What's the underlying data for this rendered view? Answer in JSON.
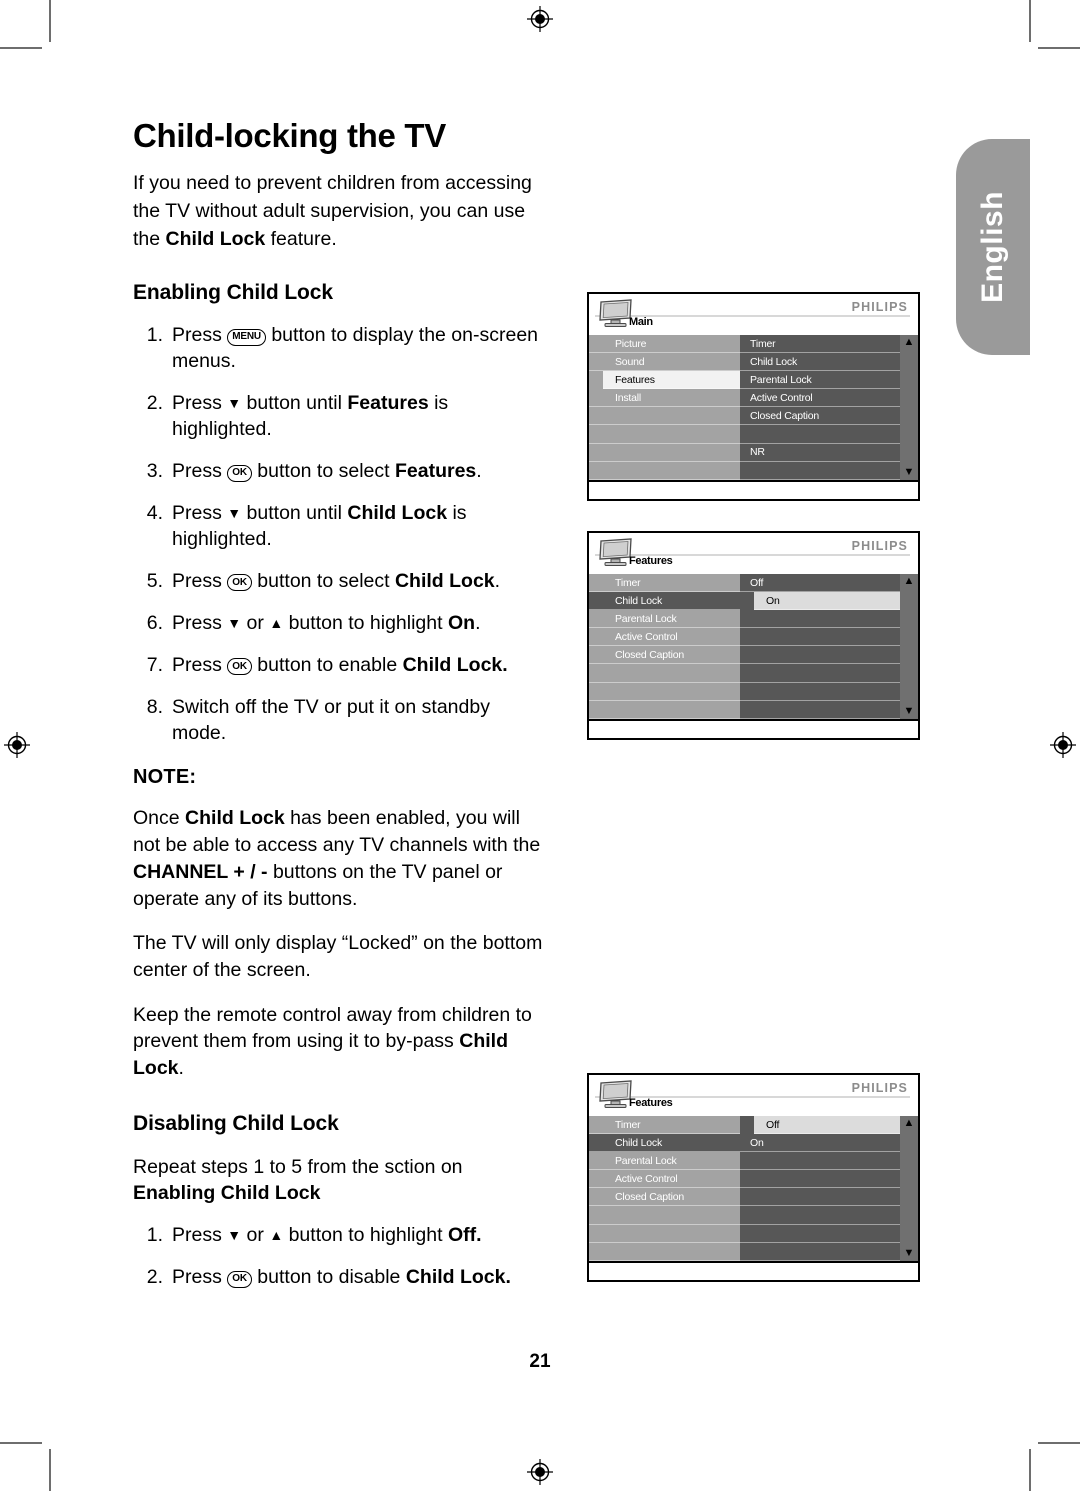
{
  "page": {
    "number": "21",
    "language_tab": "English"
  },
  "article": {
    "title": "Child-locking the TV",
    "intro_plain": "If you need to prevent children from accessing the TV without adult supervision, you can use the Child Lock feature.",
    "intro_pre": "If you need to prevent children from accessing the TV without adult supervision, you can use the ",
    "intro_bold": "Child Lock",
    "intro_post": " feature."
  },
  "enabling": {
    "heading": "Enabling Child Lock",
    "steps": [
      {
        "num": "1.",
        "pre": "Press ",
        "glyph": "MENU",
        "post": " button to display the on-screen menus.",
        "bold": ""
      },
      {
        "num": "2.",
        "pre": "Press ",
        "glyph": "▼",
        "mid": " button until ",
        "bold": "Features",
        "post": " is highlighted."
      },
      {
        "num": "3.",
        "pre": "Press ",
        "glyph": "OK",
        "mid": " button to select ",
        "bold": "Features",
        "post": "."
      },
      {
        "num": "4.",
        "pre": "Press ",
        "glyph": "▼",
        "mid": " button until ",
        "bold": "Child Lock",
        "post": " is highlighted."
      },
      {
        "num": "5.",
        "pre": "Press ",
        "glyph": "OK",
        "mid": " button to select ",
        "bold": "Child Lock",
        "post": "."
      },
      {
        "num": "6.",
        "pre": "Press ",
        "glyph": "▼",
        "mid": " or ",
        "glyph2": "▲",
        "mid2": " button to highlight ",
        "bold": "On",
        "post": "."
      },
      {
        "num": "7.",
        "pre": "Press ",
        "glyph": "OK",
        "mid": " button to enable ",
        "bold": "Child Lock.",
        "post": ""
      },
      {
        "num": "8.",
        "pre": "Switch off the TV or put it on standby mode.",
        "glyph": "",
        "post": ""
      }
    ]
  },
  "note": {
    "heading": "NOTE:",
    "paragraphs": [
      {
        "p1": "Once ",
        "b1": "Child Lock",
        "p2": " has been enabled, you will not be able to access any TV channels with the ",
        "b2": "CHANNEL + / -",
        "p3": " buttons on the TV panel or operate any of its buttons."
      },
      {
        "p1": "The TV will only display “Locked” on the bottom center of the screen.",
        "b1": "",
        "p2": "",
        "b2": "",
        "p3": ""
      },
      {
        "p1": "Keep the remote control away from children to prevent them from using it to by-pass ",
        "b1": "Child Lock",
        "p2": ".",
        "b2": "",
        "p3": ""
      }
    ]
  },
  "disabling": {
    "heading": "Disabling Child Lock",
    "repeat_pre": "Repeat steps 1 to 5 from the sction on ",
    "repeat_bold": "Enabling Child Lock",
    "steps": [
      {
        "num": "1.",
        "pre": "Press ",
        "glyph": "▼",
        "mid": " or ",
        "glyph2": "▲",
        "mid2": " button to highlight ",
        "bold": "Off.",
        "post": ""
      },
      {
        "num": "2.",
        "pre": "Press ",
        "glyph": "OK",
        "mid": " button to disable ",
        "bold": "Child Lock.",
        "post": ""
      }
    ]
  },
  "osd": {
    "brand": "PHILIPS",
    "menus": [
      {
        "id": "main-menu",
        "label": "Main",
        "left_rows": [
          {
            "text": "Picture",
            "state": "normal"
          },
          {
            "text": "Sound",
            "state": "normal"
          },
          {
            "text": "Features",
            "state": "sel-light"
          },
          {
            "text": "Install",
            "state": "normal"
          },
          {
            "text": "",
            "state": "normal"
          },
          {
            "text": "",
            "state": "normal"
          },
          {
            "text": "",
            "state": "normal"
          },
          {
            "text": "",
            "state": "normal"
          }
        ],
        "right_rows": [
          {
            "text": "Timer",
            "state": "normal"
          },
          {
            "text": "Child Lock",
            "state": "normal"
          },
          {
            "text": "Parental Lock",
            "state": "normal"
          },
          {
            "text": "Active Control",
            "state": "normal"
          },
          {
            "text": "Closed Caption",
            "state": "normal"
          },
          {
            "text": "",
            "state": "normal"
          },
          {
            "text": "NR",
            "state": "normal"
          },
          {
            "text": "",
            "state": "normal"
          }
        ]
      },
      {
        "id": "features-menu-on",
        "label": "Features",
        "left_rows": [
          {
            "text": "Timer",
            "state": "normal"
          },
          {
            "text": "Child Lock",
            "state": "sel-dark"
          },
          {
            "text": "Parental Lock",
            "state": "normal"
          },
          {
            "text": "Active Control",
            "state": "normal"
          },
          {
            "text": "Closed Caption",
            "state": "normal"
          },
          {
            "text": "",
            "state": "normal"
          },
          {
            "text": "",
            "state": "normal"
          },
          {
            "text": "",
            "state": "normal"
          }
        ],
        "right_rows": [
          {
            "text": "Off",
            "state": "normal"
          },
          {
            "text": "On",
            "state": "sel-light"
          },
          {
            "text": "",
            "state": "normal"
          },
          {
            "text": "",
            "state": "normal"
          },
          {
            "text": "",
            "state": "normal"
          },
          {
            "text": "",
            "state": "normal"
          },
          {
            "text": "",
            "state": "normal"
          },
          {
            "text": "",
            "state": "normal"
          }
        ]
      },
      {
        "id": "features-menu-off",
        "label": "Features",
        "left_rows": [
          {
            "text": "Timer",
            "state": "normal"
          },
          {
            "text": "Child Lock",
            "state": "sel-dark"
          },
          {
            "text": "Parental Lock",
            "state": "normal"
          },
          {
            "text": "Active Control",
            "state": "normal"
          },
          {
            "text": "Closed Caption",
            "state": "normal"
          },
          {
            "text": "",
            "state": "normal"
          },
          {
            "text": "",
            "state": "normal"
          },
          {
            "text": "",
            "state": "normal"
          }
        ],
        "right_rows": [
          {
            "text": "Off",
            "state": "sel-light"
          },
          {
            "text": "On",
            "state": "normal"
          },
          {
            "text": "",
            "state": "normal"
          },
          {
            "text": "",
            "state": "normal"
          },
          {
            "text": "",
            "state": "normal"
          },
          {
            "text": "",
            "state": "normal"
          },
          {
            "text": "",
            "state": "normal"
          },
          {
            "text": "",
            "state": "normal"
          }
        ]
      }
    ],
    "scroll_up": "▲",
    "scroll_down": "▼"
  },
  "colors": {
    "tab_gray": "#9a9a9a",
    "osd_left": "#a3a3a3",
    "osd_right": "#575757",
    "osd_scroll": "#707070",
    "philips_gray": "#8c8c8c",
    "highlight_light": "#f2f2f2"
  }
}
